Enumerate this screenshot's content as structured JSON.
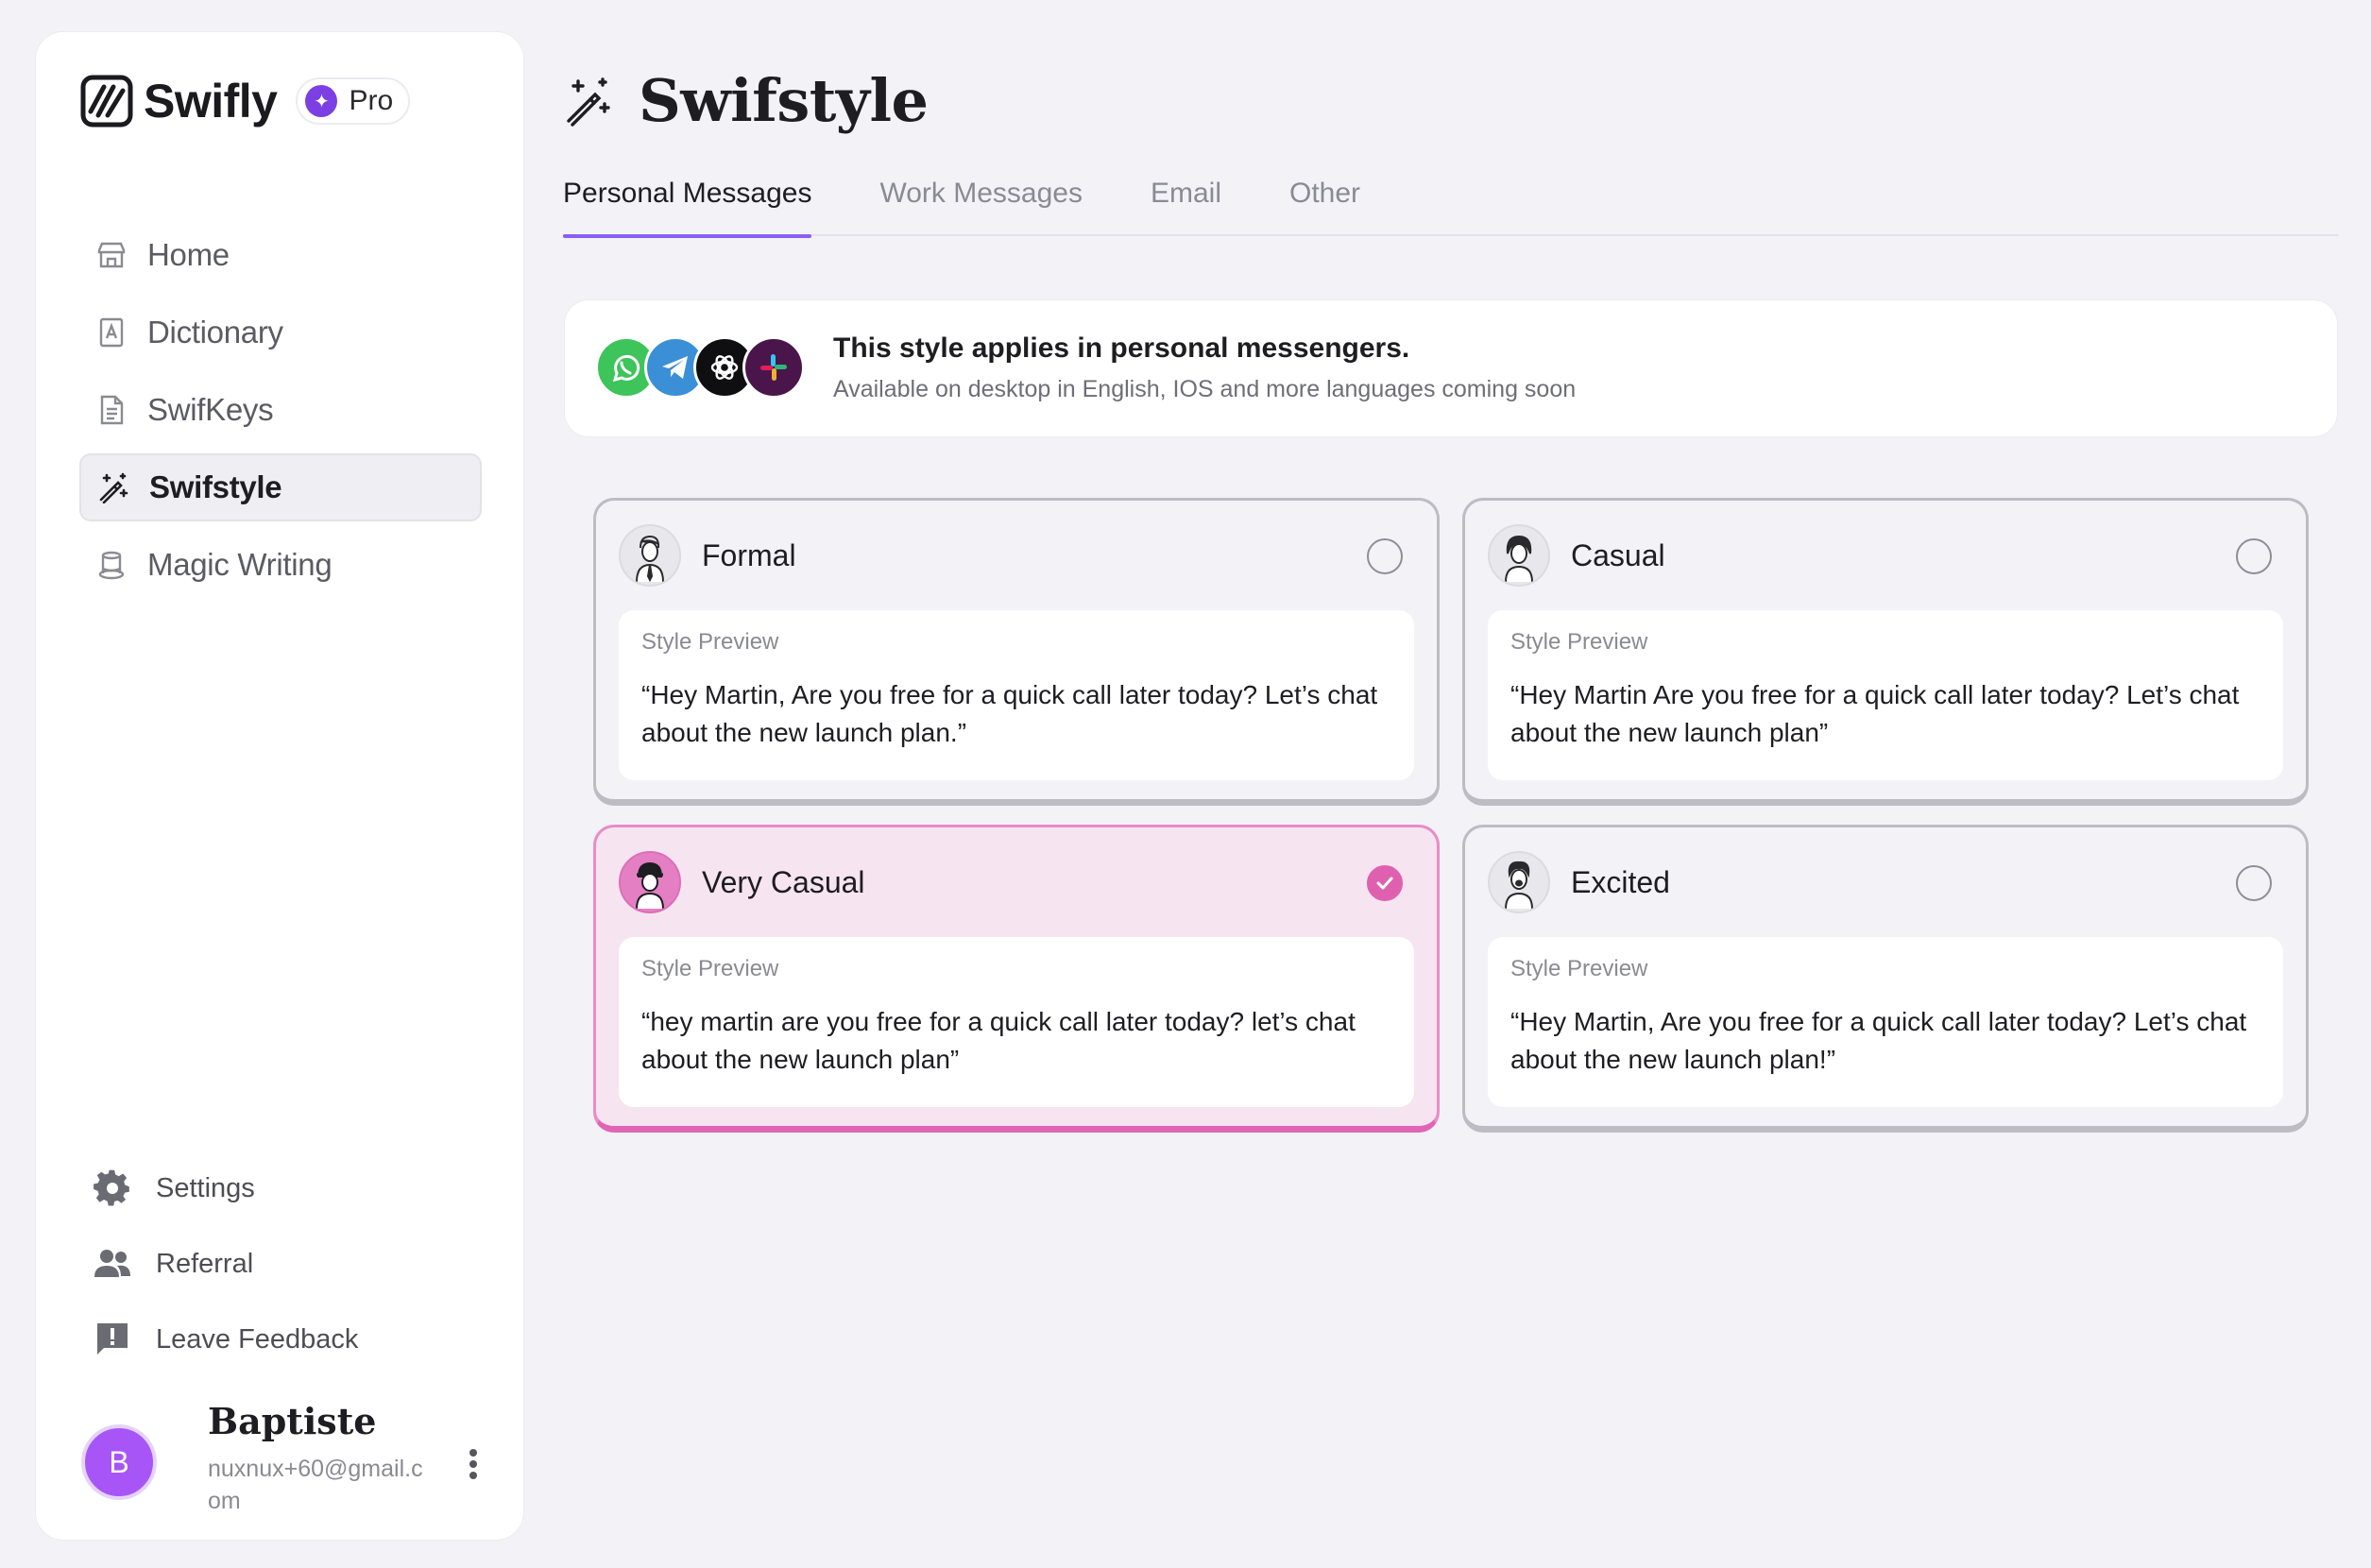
{
  "app": {
    "brand_name": "Swifly",
    "badge": "Pro",
    "accent": "#8b5cf6"
  },
  "sidebar": {
    "items": [
      {
        "label": "Home",
        "icon": "store-icon"
      },
      {
        "label": "Dictionary",
        "icon": "book-icon"
      },
      {
        "label": "SwifKeys",
        "icon": "document-icon"
      },
      {
        "label": "Swifstyle",
        "icon": "magic-wand-icon",
        "active": true
      },
      {
        "label": "Magic Writing",
        "icon": "top-hat-icon"
      }
    ],
    "bottom_items": [
      {
        "label": "Settings",
        "icon": "gear-icon"
      },
      {
        "label": "Referral",
        "icon": "people-icon"
      },
      {
        "label": "Leave Feedback",
        "icon": "feedback-icon"
      }
    ],
    "user": {
      "initial": "B",
      "name": "Baptiste",
      "email": "nuxnux+60@gmail.com"
    }
  },
  "main": {
    "title": "Swifstyle",
    "tabs": [
      {
        "label": "Personal Messages",
        "active": true
      },
      {
        "label": "Work Messages"
      },
      {
        "label": "Email"
      },
      {
        "label": "Other"
      }
    ],
    "info": {
      "title": "This style applies in personal messengers.",
      "subtitle": "Available on desktop in English, IOS and more languages coming soon",
      "apps": [
        "whatsapp-icon",
        "telegram-icon",
        "chatgpt-icon",
        "slack-icon"
      ]
    },
    "styles": [
      {
        "name": "Formal",
        "preview_label": "Style Preview",
        "preview": "“Hey Martin, Are you free for a quick call later today? Let’s chat about the new launch plan.”",
        "selected": false
      },
      {
        "name": "Casual",
        "preview_label": "Style Preview",
        "preview": "“Hey Martin Are you free for a quick call later today? Let’s chat about the new launch plan”",
        "selected": false
      },
      {
        "name": "Very Casual",
        "preview_label": "Style Preview",
        "preview": "“hey martin are you free for a quick call later today? let’s chat about the new launch plan”",
        "selected": true
      },
      {
        "name": "Excited",
        "preview_label": "Style Preview",
        "preview": "“Hey Martin, Are you free for a quick call later today? Let’s chat about the new launch plan!”",
        "selected": false
      }
    ]
  }
}
